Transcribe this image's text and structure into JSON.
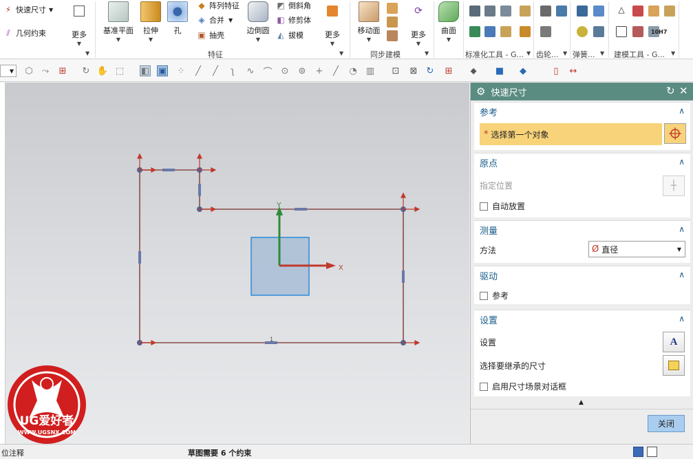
{
  "ribbon": {
    "sketch": {
      "quick_dim": "快速尺寸",
      "geo_constraint": "几何约束",
      "more": "更多"
    },
    "feature": {
      "datum_plane": "基准平面",
      "extrude": "拉伸",
      "hole": "孔",
      "pattern": "阵列特征",
      "unite": "合并",
      "shell": "抽壳",
      "edge_blend": "边倒圆",
      "chamfer": "倒斜角",
      "trim_body": "修剪体",
      "draft": "拔模",
      "more": "更多",
      "group_label": "特征"
    },
    "sync": {
      "move_face": "移动面",
      "more": "更多",
      "group_label": "同步建模"
    },
    "surface": {
      "curve_surface": "曲面"
    },
    "std_tools": {
      "group_label": "标准化工具 - G..."
    },
    "gear": {
      "group_label": "齿轮..."
    },
    "spring": {
      "group_label": "弹簧..."
    },
    "modeling_tools": {
      "group_label": "建模工具 - G..."
    },
    "badge_10h7": "10H7"
  },
  "canvas": {
    "axis_x": "X",
    "axis_y": "Y",
    "dim_label": "1"
  },
  "dialog": {
    "title": "快速尺寸",
    "reference": {
      "header": "参考",
      "required_mark": "*",
      "select_first": "选择第一个对象"
    },
    "origin": {
      "header": "原点",
      "specify_location": "指定位置",
      "auto_place": "自动放置"
    },
    "measure": {
      "header": "测量",
      "method_label": "方法",
      "method_value": "直径"
    },
    "driving": {
      "header": "驱动",
      "reference": "参考"
    },
    "settings": {
      "header": "设置",
      "settings_label": "设置",
      "inherit_label": "选择要继承的尺寸",
      "enable_scene": "启用尺寸场景对话框"
    },
    "close": "关闭"
  },
  "watermark": {
    "brand": "UG爱好者",
    "url": "WWW.UGSNX.COM"
  },
  "status": {
    "left": "位注释",
    "center_prefix": "草图需要 ",
    "center_count": "6",
    "center_suffix": " 个约束"
  },
  "colors": {
    "dialog_title": "#5b8c82",
    "section_header": "#1a5d8a",
    "sketch_line": "#8a4a4a",
    "select_highlight": "#f8d37a",
    "close_button": "#a9cdee"
  }
}
